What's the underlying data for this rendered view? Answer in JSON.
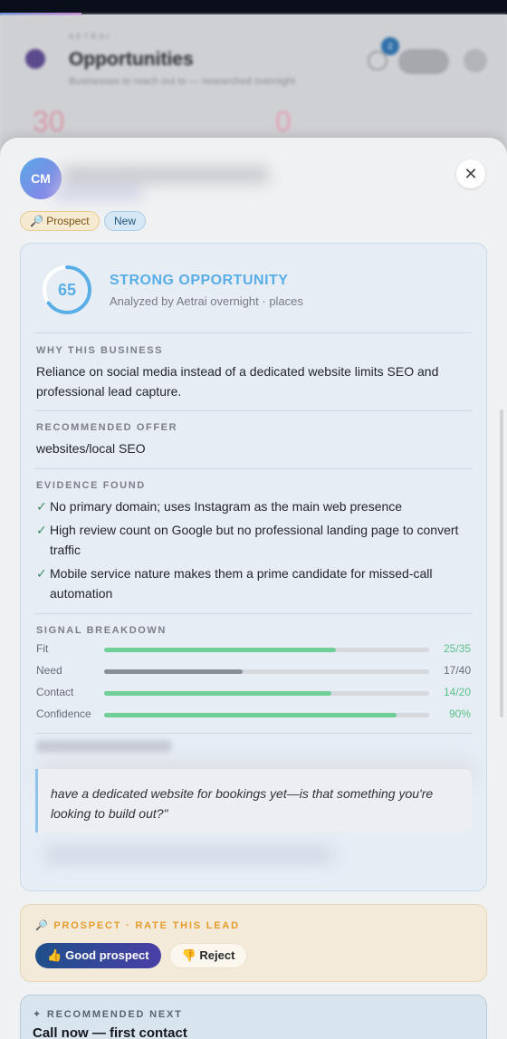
{
  "background": {
    "eyebrow": "AETRAI",
    "title": "Opportunities",
    "subtitle": "Businesses to reach out to — researched overnight",
    "badge_count": "2",
    "stat_a": "30",
    "stat_b": "0"
  },
  "lead": {
    "initials": "CM",
    "tags": {
      "prospect": "🔎 Prospect",
      "new": "New"
    },
    "close_icon": "close-icon"
  },
  "analysis": {
    "score": "65",
    "score_fraction": 0.65,
    "verdict": "STRONG OPPORTUNITY",
    "analyzed_by": "Analyzed by Aetrai overnight · places",
    "why_label": "WHY THIS BUSINESS",
    "why_text": "Reliance on social media instead of a dedicated website limits SEO and professional lead capture.",
    "offer_label": "RECOMMENDED OFFER",
    "offer_text": "websites/local SEO",
    "evidence_label": "EVIDENCE FOUND",
    "evidence": [
      "No primary domain; uses Instagram as the main web presence",
      "High review count on Google but no professional landing page to convert traffic",
      "Mobile service nature makes them a prime candidate for missed-call automation"
    ],
    "signal_label": "SIGNAL BREAKDOWN",
    "signals": [
      {
        "label": "Fit",
        "value": "25/35",
        "fraction": 0.714,
        "color": "#6fcf97"
      },
      {
        "label": "Need",
        "value": "17/40",
        "fraction": 0.425,
        "color": "#8a8e96"
      },
      {
        "label": "Contact",
        "value": "14/20",
        "fraction": 0.7,
        "color": "#6fcf97"
      },
      {
        "label": "Confidence",
        "value": "90%",
        "fraction": 0.9,
        "color": "#6fcf97"
      }
    ],
    "opening_quote": "have a dedicated website for bookings yet—is that something you're looking to build out?\""
  },
  "rating": {
    "label": "🔎 PROSPECT · RATE THIS LEAD",
    "good_button": "👍 Good prospect",
    "reject_button": "👎 Reject"
  },
  "next": {
    "label": "✦ RECOMMENDED NEXT",
    "action": "Call now — first contact"
  },
  "colors": {
    "accent_blue": "#5aaee6",
    "positive": "#6fcf97",
    "prospect_orange": "#e59c2c"
  }
}
